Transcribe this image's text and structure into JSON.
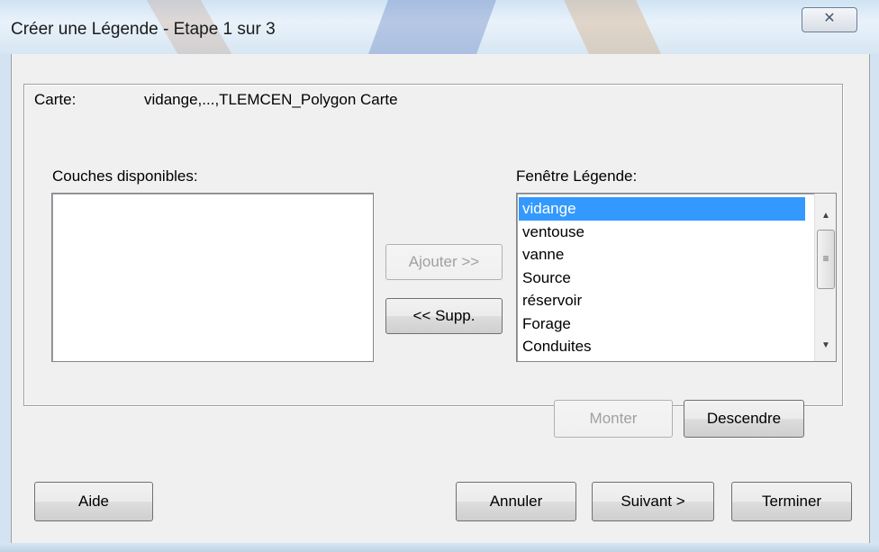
{
  "window": {
    "title": "Créer une Légende - Etape 1 sur 3",
    "close_label": "⌦"
  },
  "map": {
    "label": "Carte:",
    "value": "vidange,...,TLEMCEN_Polygon Carte"
  },
  "available_layers": {
    "label": "Couches disponibles:",
    "items": []
  },
  "legend_window": {
    "label": "Fenêtre Légende:",
    "items": [
      "vidange",
      "ventouse",
      "vanne",
      "Source",
      "réservoir",
      "Forage",
      "Conduites"
    ],
    "selected_index": 0
  },
  "buttons": {
    "add": "Ajouter >>",
    "remove": "<< Supp.",
    "up": "Monter",
    "down": "Descendre",
    "help": "Aide",
    "cancel": "Annuler",
    "next": "Suivant >",
    "finish": "Terminer"
  },
  "colors": {
    "selection": "#3399ff",
    "dialog_bg": "#f0f0f0"
  }
}
